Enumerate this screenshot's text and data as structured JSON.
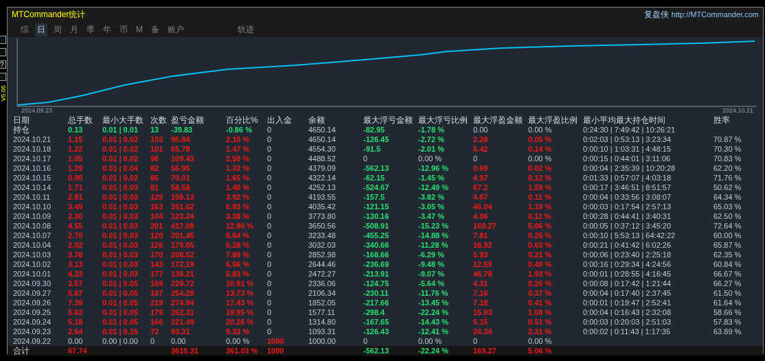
{
  "side_strip": {
    "help": "?",
    "version": "V5.05"
  },
  "header": {
    "title": "MTCommander统计",
    "brand": "复盘侠",
    "url": "http://MTCommander.com"
  },
  "tabs": [
    {
      "label": "综",
      "selected": false
    },
    {
      "label": "日",
      "selected": true
    },
    {
      "label": "周",
      "selected": false
    },
    {
      "label": "月",
      "selected": false
    },
    {
      "label": "季",
      "selected": false
    },
    {
      "label": "年",
      "selected": false
    },
    {
      "label": "币",
      "selected": false
    },
    {
      "label": "M",
      "selected": false
    },
    {
      "label": "备",
      "selected": false
    },
    {
      "label": "账户",
      "selected": false
    }
  ],
  "track_tab": {
    "label": "轨迹",
    "selected": false
  },
  "equity_chart": {
    "start_label": "2024.09.23",
    "end_label": "2024.10.21"
  },
  "table": {
    "columns": [
      "日期",
      "总手数",
      "最小大手数",
      "次数",
      "盈亏金额",
      "百分比%",
      "出入金",
      "余额",
      "最大浮亏金额",
      "最大浮亏比例",
      "最大浮盈金额",
      "最大浮盈比例",
      "最小平均最大持仓时间",
      "胜率"
    ],
    "rows": [
      {
        "kind": "open",
        "cells": [
          "持仓",
          {
            "text": "0.13",
            "color": "#22e070"
          },
          {
            "text": "0.01 | 0.01",
            "color": "#22e070"
          },
          {
            "text": "13",
            "color": "#22e070"
          },
          {
            "text": "-39.83",
            "color": "#22e070"
          },
          {
            "text": "-0.86 %",
            "color": "#22e070"
          },
          "0",
          "4650.14",
          {
            "text": "-82.95",
            "color": "#22e070"
          },
          {
            "text": "-1.78 %",
            "color": "#22e070"
          },
          "0.00",
          "0.00 %",
          "0:24:30 | 7:49:42 | 10:26:21",
          null
        ]
      },
      {
        "kind": "day",
        "cells": [
          "2024.10.21",
          {
            "text": "1.15",
            "color": "#f01818"
          },
          {
            "text": "0.01 | 0.02",
            "color": "#f01818"
          },
          {
            "text": "103",
            "color": "#f01818"
          },
          {
            "text": "95.84",
            "color": "#f01818"
          },
          {
            "text": "2.10 %",
            "color": "#f01818"
          },
          "0",
          "4650.14",
          {
            "text": "-126.45",
            "color": "#22e070"
          },
          {
            "text": "-2.72 %",
            "color": "#22e070"
          },
          {
            "text": "2.28",
            "color": "#f01818"
          },
          {
            "text": "0.05 %",
            "color": "#f01818"
          },
          "0:02:03 | 0:53:13 | 3:23:34",
          "70.87 %"
        ]
      },
      {
        "kind": "day",
        "cells": [
          "2024.10.18",
          {
            "text": "1.22",
            "color": "#f01818"
          },
          {
            "text": "0.01 | 0.02",
            "color": "#f01818"
          },
          {
            "text": "101",
            "color": "#f01818"
          },
          {
            "text": "65.78",
            "color": "#f01818"
          },
          {
            "text": "1.47 %",
            "color": "#f01818"
          },
          "0",
          "4554.30",
          {
            "text": "-91.5",
            "color": "#22e070"
          },
          {
            "text": "-2.01 %",
            "color": "#22e070"
          },
          {
            "text": "6.42",
            "color": "#f01818"
          },
          {
            "text": "0.14 %",
            "color": "#f01818"
          },
          "0:00:10 | 1:03:31 | 4:48:15",
          "70.30 %"
        ]
      },
      {
        "kind": "day",
        "cells": [
          "2024.10.17",
          {
            "text": "1.05",
            "color": "#f01818"
          },
          {
            "text": "0.01 | 0.02",
            "color": "#f01818"
          },
          {
            "text": "96",
            "color": "#f01818"
          },
          {
            "text": "109.43",
            "color": "#f01818"
          },
          {
            "text": "2.50 %",
            "color": "#f01818"
          },
          "0",
          "4488.52",
          "0",
          "0.00 %",
          "0",
          "0.00 %",
          "0:00:15 | 0:44:01 | 3:11:06",
          "70.83 %"
        ]
      },
      {
        "kind": "day",
        "cells": [
          "2024.10.16",
          {
            "text": "1.29",
            "color": "#f01818"
          },
          {
            "text": "0.01 | 0.04",
            "color": "#f01818"
          },
          {
            "text": "82",
            "color": "#f01818"
          },
          {
            "text": "56.95",
            "color": "#f01818"
          },
          {
            "text": "1.32 %",
            "color": "#f01818"
          },
          "0",
          "4379.09",
          {
            "text": "-562.13",
            "color": "#22e070"
          },
          {
            "text": "-12.96 %",
            "color": "#22e070"
          },
          {
            "text": "0.69",
            "color": "#f01818"
          },
          {
            "text": "0.02 %",
            "color": "#f01818"
          },
          "0:00:04 | 2:35:39 | 10:20:28",
          "62.20 %"
        ]
      },
      {
        "kind": "day",
        "cells": [
          "2024.10.15",
          {
            "text": "0.90",
            "color": "#f01818"
          },
          {
            "text": "0.01 | 0.02",
            "color": "#f01818"
          },
          {
            "text": "85",
            "color": "#f01818"
          },
          {
            "text": "70.01",
            "color": "#f01818"
          },
          {
            "text": "1.65 %",
            "color": "#f01818"
          },
          "0",
          "4322.14",
          {
            "text": "-62.15",
            "color": "#22e070"
          },
          {
            "text": "-1.45 %",
            "color": "#22e070"
          },
          {
            "text": "4.97",
            "color": "#f01818"
          },
          {
            "text": "0.12 %",
            "color": "#f01818"
          },
          "0:01:33 | 0:57:07 | 4:03:18",
          "71.76 %"
        ]
      },
      {
        "kind": "day",
        "cells": [
          "2024.10.14",
          {
            "text": "1.71",
            "color": "#f01818"
          },
          {
            "text": "0.01 | 0.03",
            "color": "#f01818"
          },
          {
            "text": "81",
            "color": "#f01818"
          },
          {
            "text": "58.58",
            "color": "#f01818"
          },
          {
            "text": "1.40 %",
            "color": "#f01818"
          },
          "0",
          "4252.13",
          {
            "text": "-524.67",
            "color": "#22e070"
          },
          {
            "text": "-12.49 %",
            "color": "#22e070"
          },
          {
            "text": "67.2",
            "color": "#f01818"
          },
          {
            "text": "1.59 %",
            "color": "#f01818"
          },
          "0:00:17 | 3:46:51 | 8:51:57",
          "50.62 %"
        ]
      },
      {
        "kind": "day",
        "cells": [
          "2024.10.11",
          {
            "text": "2.91",
            "color": "#f01818"
          },
          {
            "text": "0.01 | 0.03",
            "color": "#f01818"
          },
          {
            "text": "129",
            "color": "#f01818"
          },
          {
            "text": "158.13",
            "color": "#f01818"
          },
          {
            "text": "3.92 %",
            "color": "#f01818"
          },
          "0",
          "4193.55",
          {
            "text": "-157.5",
            "color": "#22e070"
          },
          {
            "text": "-3.82 %",
            "color": "#22e070"
          },
          {
            "text": "4.67",
            "color": "#f01818"
          },
          {
            "text": "0.11 %",
            "color": "#f01818"
          },
          "0:00:04 | 0:33:56 | 3:08:07",
          "64.34 %"
        ]
      },
      {
        "kind": "day",
        "cells": [
          "2024.10.10",
          {
            "text": "3.49",
            "color": "#f01818"
          },
          {
            "text": "0.01 | 0.03",
            "color": "#f01818"
          },
          {
            "text": "163",
            "color": "#f01818"
          },
          {
            "text": "261.62",
            "color": "#f01818"
          },
          {
            "text": "6.93 %",
            "color": "#f01818"
          },
          "0",
          "4035.42",
          {
            "text": "-121.15",
            "color": "#22e070"
          },
          {
            "text": "-3.05 %",
            "color": "#22e070"
          },
          {
            "text": "46.04",
            "color": "#f01818"
          },
          {
            "text": "1.19 %",
            "color": "#f01818"
          },
          "0:00:03 | 0:17:54 | 2:57:13",
          "65.03 %"
        ]
      },
      {
        "kind": "day",
        "cells": [
          "2024.10.09",
          {
            "text": "2.30",
            "color": "#f01818"
          },
          {
            "text": "0.01 | 0.03",
            "color": "#f01818"
          },
          {
            "text": "104",
            "color": "#f01818"
          },
          {
            "text": "123.24",
            "color": "#f01818"
          },
          {
            "text": "3.38 %",
            "color": "#f01818"
          },
          "0",
          "3773.80",
          {
            "text": "-130.16",
            "color": "#22e070"
          },
          {
            "text": "-3.47 %",
            "color": "#22e070"
          },
          {
            "text": "4.06",
            "color": "#f01818"
          },
          {
            "text": "0.11 %",
            "color": "#f01818"
          },
          "0:00:28 | 0:44:41 | 3:40:31",
          "62.50 %"
        ]
      },
      {
        "kind": "day",
        "cells": [
          "2024.10.08",
          {
            "text": "4.55",
            "color": "#f01818"
          },
          {
            "text": "0.01 | 0.03",
            "color": "#f01818"
          },
          {
            "text": "201",
            "color": "#f01818"
          },
          {
            "text": "417.08",
            "color": "#f01818"
          },
          {
            "text": "12.90 %",
            "color": "#f01818"
          },
          "0",
          "3650.56",
          {
            "text": "-508.91",
            "color": "#22e070"
          },
          {
            "text": "-15.23 %",
            "color": "#22e070"
          },
          {
            "text": "169.27",
            "color": "#f01818"
          },
          {
            "text": "5.06 %",
            "color": "#f01818"
          },
          "0:00:05 | 0:37:12 | 3:45:20",
          "72.64 %"
        ]
      },
      {
        "kind": "day",
        "cells": [
          "2024.10.07",
          {
            "text": "2.70",
            "color": "#f01818"
          },
          {
            "text": "0.01 | 0.03",
            "color": "#f01818"
          },
          {
            "text": "120",
            "color": "#f01818"
          },
          {
            "text": "201.45",
            "color": "#f01818"
          },
          {
            "text": "6.64 %",
            "color": "#f01818"
          },
          "0",
          "3233.48",
          {
            "text": "-455.25",
            "color": "#22e070"
          },
          {
            "text": "-14.88 %",
            "color": "#22e070"
          },
          {
            "text": "7.81",
            "color": "#f01818"
          },
          {
            "text": "0.25 %",
            "color": "#f01818"
          },
          "0:00:10 | 5:53:13 | 64:42:22",
          "60.00 %"
        ]
      },
      {
        "kind": "day",
        "cells": [
          "2024.10.04",
          {
            "text": "2.92",
            "color": "#f01818"
          },
          {
            "text": "0.01 | 0.03",
            "color": "#f01818"
          },
          {
            "text": "126",
            "color": "#f01818"
          },
          {
            "text": "179.05",
            "color": "#f01818"
          },
          {
            "text": "6.28 %",
            "color": "#f01818"
          },
          "0",
          "3032.03",
          {
            "text": "-340.66",
            "color": "#22e070"
          },
          {
            "text": "-11.28 %",
            "color": "#22e070"
          },
          {
            "text": "18.92",
            "color": "#f01818"
          },
          {
            "text": "0.63 %",
            "color": "#f01818"
          },
          "0:00:21 | 0:41:42 | 6:02:26",
          "65.87 %"
        ]
      },
      {
        "kind": "day",
        "cells": [
          "2024.10.03",
          {
            "text": "3.78",
            "color": "#f01818"
          },
          {
            "text": "0.01 | 0.03",
            "color": "#f01818"
          },
          {
            "text": "170",
            "color": "#f01818"
          },
          {
            "text": "208.52",
            "color": "#f01818"
          },
          {
            "text": "7.89 %",
            "color": "#f01818"
          },
          "0",
          "2852.98",
          {
            "text": "-168.66",
            "color": "#22e070"
          },
          {
            "text": "-6.29 %",
            "color": "#22e070"
          },
          {
            "text": "5.93",
            "color": "#f01818"
          },
          {
            "text": "0.21 %",
            "color": "#f01818"
          },
          "0:00:06 | 0:23:40 | 2:25:18",
          "62.35 %"
        ]
      },
      {
        "kind": "day",
        "cells": [
          "2024.10.02",
          {
            "text": "3.13",
            "color": "#f01818"
          },
          {
            "text": "0.01 | 0.03",
            "color": "#f01818"
          },
          {
            "text": "143",
            "color": "#f01818"
          },
          {
            "text": "172.19",
            "color": "#f01818"
          },
          {
            "text": "6.96 %",
            "color": "#f01818"
          },
          "0",
          "2644.46",
          {
            "text": "-236.69",
            "color": "#22e070"
          },
          {
            "text": "-9.48 %",
            "color": "#22e070"
          },
          {
            "text": "12.59",
            "color": "#f01818"
          },
          {
            "text": "0.49 %",
            "color": "#f01818"
          },
          "0:00:16 | 0:29:34 | 4:24:56",
          "60.84 %"
        ]
      },
      {
        "kind": "day",
        "cells": [
          "2024.10.01",
          {
            "text": "4.23",
            "color": "#f01818"
          },
          {
            "text": "0.01 | 0.03",
            "color": "#f01818"
          },
          {
            "text": "177",
            "color": "#f01818"
          },
          {
            "text": "136.21",
            "color": "#f01818"
          },
          {
            "text": "5.83 %",
            "color": "#f01818"
          },
          "0",
          "2472.27",
          {
            "text": "-213.91",
            "color": "#22e070"
          },
          {
            "text": "-9.07 %",
            "color": "#22e070"
          },
          {
            "text": "46.78",
            "color": "#f01818"
          },
          {
            "text": "1.93 %",
            "color": "#f01818"
          },
          "0:00:01 | 0:28:55 | 4:16:45",
          "66.67 %"
        ]
      },
      {
        "kind": "day",
        "cells": [
          "2024.09.30",
          {
            "text": "3.57",
            "color": "#f01818"
          },
          {
            "text": "0.01 | 0.05",
            "color": "#f01818"
          },
          {
            "text": "169",
            "color": "#f01818"
          },
          {
            "text": "229.72",
            "color": "#f01818"
          },
          {
            "text": "10.91 %",
            "color": "#f01818"
          },
          "0",
          "2336.06",
          {
            "text": "-124.75",
            "color": "#22e070"
          },
          {
            "text": "-5.64 %",
            "color": "#22e070"
          },
          {
            "text": "4.31",
            "color": "#f01818"
          },
          {
            "text": "0.20 %",
            "color": "#f01818"
          },
          "0:00:08 | 0:17:42 | 1:21:44",
          "66.27 %"
        ]
      },
      {
        "kind": "day",
        "cells": [
          "2024.09.27",
          {
            "text": "5.87",
            "color": "#f01818"
          },
          {
            "text": "0.01 | 0.05",
            "color": "#f01818"
          },
          {
            "text": "187",
            "color": "#f01818"
          },
          {
            "text": "254.29",
            "color": "#f01818"
          },
          {
            "text": "13.73 %",
            "color": "#f01818"
          },
          "0",
          "2106.34",
          {
            "text": "-230.11",
            "color": "#22e070"
          },
          {
            "text": "-11.76 %",
            "color": "#22e070"
          },
          {
            "text": "7.16",
            "color": "#f01818"
          },
          {
            "text": "0.37 %",
            "color": "#f01818"
          },
          "0:00:04 | 0:17:40 | 2:37:45",
          "61.50 %"
        ]
      },
      {
        "kind": "day",
        "cells": [
          "2024.09.26",
          {
            "text": "7.39",
            "color": "#f01818"
          },
          {
            "text": "0.01 | 0.05",
            "color": "#f01818"
          },
          {
            "text": "219",
            "color": "#f01818"
          },
          {
            "text": "274.94",
            "color": "#f01818"
          },
          {
            "text": "17.43 %",
            "color": "#f01818"
          },
          "0",
          "1852.05",
          {
            "text": "-217.66",
            "color": "#22e070"
          },
          {
            "text": "-13.45 %",
            "color": "#22e070"
          },
          {
            "text": "7.18",
            "color": "#f01818"
          },
          {
            "text": "0.41 %",
            "color": "#f01818"
          },
          "0:00:01 | 0:19:47 | 2:52:41",
          "61.64 %"
        ]
      },
      {
        "kind": "day",
        "cells": [
          "2024.09.25",
          {
            "text": "5.63",
            "color": "#f01818"
          },
          {
            "text": "0.01 | 0.05",
            "color": "#f01818"
          },
          {
            "text": "179",
            "color": "#f01818"
          },
          {
            "text": "262.31",
            "color": "#f01818"
          },
          {
            "text": "19.95 %",
            "color": "#f01818"
          },
          "0",
          "1577.11",
          {
            "text": "-298.4",
            "color": "#22e070"
          },
          {
            "text": "-22.24 %",
            "color": "#22e070"
          },
          {
            "text": "15.93",
            "color": "#f01818"
          },
          {
            "text": "1.08 %",
            "color": "#f01818"
          },
          "0:00:04 | 0:16:43 | 2:32:08",
          "58.66 %"
        ]
      },
      {
        "kind": "day",
        "cells": [
          "2024.09.24",
          {
            "text": "5.18",
            "color": "#f01818"
          },
          {
            "text": "0.01 | 0.05",
            "color": "#f01818"
          },
          {
            "text": "166",
            "color": "#f01818"
          },
          {
            "text": "221.49",
            "color": "#f01818"
          },
          {
            "text": "20.26 %",
            "color": "#f01818"
          },
          "0",
          "1314.80",
          {
            "text": "-167.65",
            "color": "#22e070"
          },
          {
            "text": "-14.43 %",
            "color": "#22e070"
          },
          {
            "text": "6.15",
            "color": "#f01818"
          },
          {
            "text": "0.51 %",
            "color": "#f01818"
          },
          "0:00:03 | 0:20:03 | 2:51:03",
          "57.83 %"
        ]
      },
      {
        "kind": "day",
        "cells": [
          "2024.09.23",
          {
            "text": "2.64",
            "color": "#f01818"
          },
          {
            "text": "0.01 | 0.25",
            "color": "#f01818"
          },
          {
            "text": "72",
            "color": "#f01818"
          },
          {
            "text": "93.31",
            "color": "#f01818"
          },
          {
            "text": "9.33 %",
            "color": "#f01818"
          },
          "0",
          "1093.31",
          {
            "text": "-126.43",
            "color": "#22e070"
          },
          {
            "text": "-12.41 %",
            "color": "#22e070"
          },
          {
            "text": "24.34",
            "color": "#f01818"
          },
          {
            "text": "2.31 %",
            "color": "#f01818"
          },
          "0:00:02 | 0:11:43 | 1:17:35",
          "63.89 %"
        ]
      },
      {
        "kind": "day",
        "cells": [
          "2024.09.22",
          "0.00",
          "0.00 | 0.00",
          "0",
          "0.00",
          "0.00 %",
          {
            "text": "1000",
            "color": "#f01818"
          },
          "1000.00",
          "0",
          "0.00 %",
          "0",
          "0.00 %",
          null,
          null
        ]
      },
      {
        "kind": "total",
        "cells": [
          "合计",
          {
            "text": "67.74",
            "color": "#f01818"
          },
          null,
          null,
          {
            "text": "3610.31",
            "color": "#f01818"
          },
          {
            "text": "361.03 %",
            "color": "#f01818"
          },
          {
            "text": "1000",
            "color": "#f01818"
          },
          null,
          {
            "text": "-562.13",
            "color": "#22e070"
          },
          {
            "text": "-22.24 %",
            "color": "#22e070"
          },
          {
            "text": "169.27",
            "color": "#f01818"
          },
          {
            "text": "5.06 %",
            "color": "#f01818"
          },
          null,
          null
        ]
      }
    ]
  }
}
